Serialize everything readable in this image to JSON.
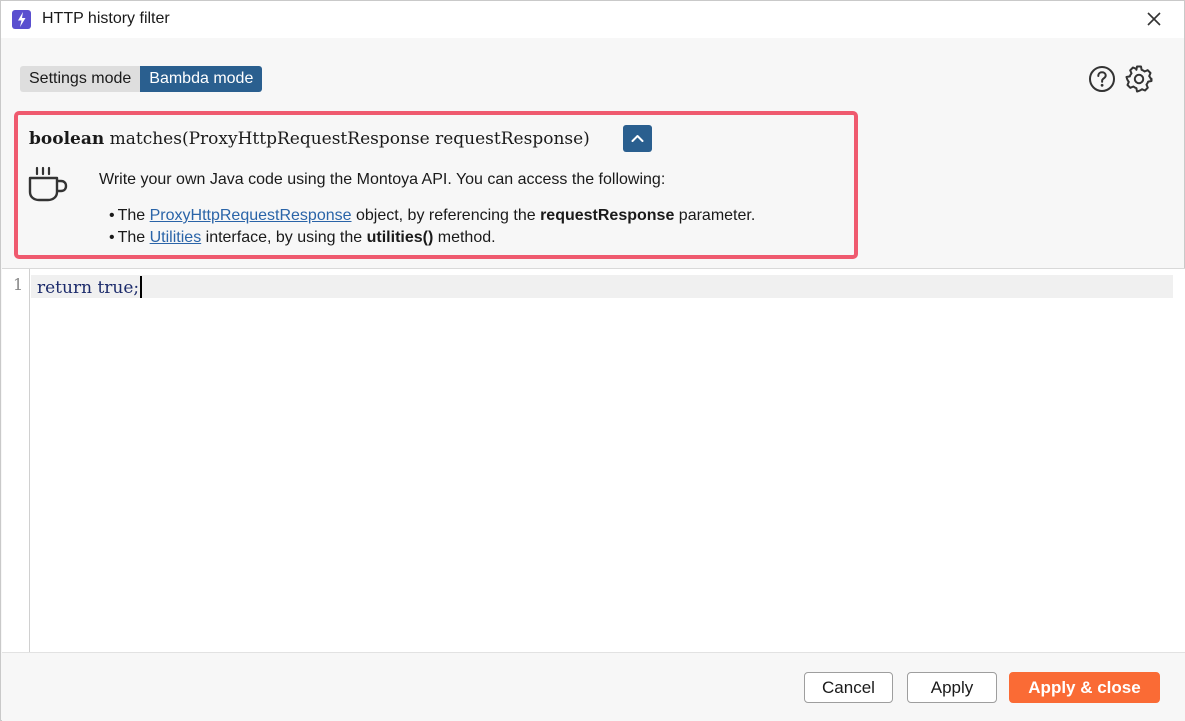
{
  "window": {
    "title": "HTTP history filter"
  },
  "mode_toggle": {
    "settings_label": "Settings mode",
    "bambda_label": "Bambda mode",
    "active": "Bambda mode"
  },
  "toolbar": {
    "help_icon": "help-circle-icon",
    "settings_icon": "gear-icon"
  },
  "info": {
    "signature_keyword": "boolean",
    "signature_rest": " matches(ProxyHttpRequestResponse requestResponse)",
    "intro": "Write your own Java code using the Montoya API. You can access the following:",
    "bullet1": {
      "prefix": "The ",
      "link": "ProxyHttpRequestResponse",
      "middle": " object, by referencing the ",
      "bold": "requestResponse",
      "suffix": " parameter."
    },
    "bullet2": {
      "prefix": "The ",
      "link": "Utilities",
      "middle": " interface, by using the ",
      "bold": "utilities()",
      "suffix": " method."
    }
  },
  "editor": {
    "line_number": "1",
    "code": "return true;"
  },
  "footer": {
    "cancel_label": "Cancel",
    "apply_label": "Apply",
    "apply_close_label": "Apply & close"
  },
  "colors": {
    "accent_blue": "#2a5f8f",
    "highlight_border": "#ef5a6f",
    "primary_orange": "#fa6b35",
    "link": "#2a64a8"
  }
}
